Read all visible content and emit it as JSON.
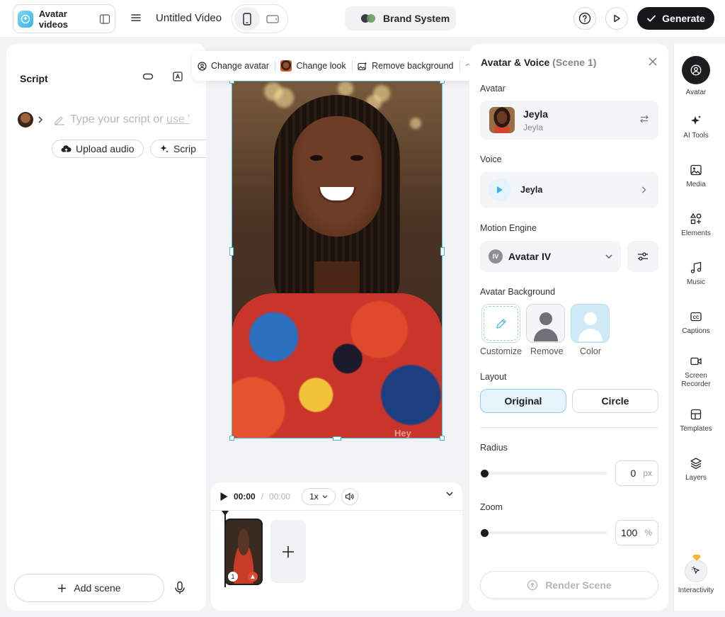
{
  "topbar": {
    "project_label": "Avatar videos",
    "video_title": "Untitled Video",
    "brand_label": "Brand System",
    "generate_label": "Generate"
  },
  "script": {
    "title": "Script",
    "placeholder_prefix": "Type your script or ",
    "placeholder_link": "use '",
    "upload_audio": "Upload audio",
    "script_ai": "Scrip",
    "add_scene": "Add scene"
  },
  "toolbar": {
    "change_avatar": "Change avatar",
    "change_look": "Change look",
    "remove_background": "Remove background"
  },
  "canvas": {
    "watermark": "Hey"
  },
  "timeline": {
    "current_time": "00:00",
    "separator": "/",
    "total_time": "00:00",
    "speed": "1x",
    "clip_number": "1"
  },
  "panel": {
    "title": "Avatar & Voice",
    "scene_label": "(Scene 1)",
    "avatar_label": "Avatar",
    "avatar_name": "Jeyla",
    "avatar_sub": "Jeyla",
    "voice_label": "Voice",
    "voice_name": "Jeyla",
    "motion_label": "Motion Engine",
    "motion_badge": "IV",
    "motion_value": "Avatar IV",
    "bg_label": "Avatar Background",
    "bg_options": [
      "Customize",
      "Remove",
      "Color"
    ],
    "layout_label": "Layout",
    "layout_options": [
      "Original",
      "Circle"
    ],
    "layout_selected": "Original",
    "radius_label": "Radius",
    "radius_value": "0",
    "radius_unit": "px",
    "zoom_label": "Zoom",
    "zoom_value": "100",
    "zoom_unit": "%",
    "render_label": "Render Scene"
  },
  "rail": {
    "items": [
      "Avatar",
      "AI Tools",
      "Media",
      "Elements",
      "Music",
      "Captions",
      "Screen Recorder",
      "Templates",
      "Layers",
      "Interactivity"
    ],
    "active": "Avatar"
  },
  "colors": {
    "accent": "#4bbcd6",
    "selected_bg": "#e5f3fb",
    "dark": "#1d1d1f"
  }
}
